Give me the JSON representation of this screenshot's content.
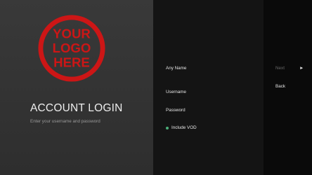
{
  "branding": {
    "logo_lines": [
      "YOUR",
      "LOGO",
      "HERE"
    ],
    "logo_color": "#cc1616"
  },
  "login": {
    "title": "ACCOUNT LOGIN",
    "subtitle": "Enter your username and password"
  },
  "form": {
    "name_label": "Any Name",
    "username_label": "Username",
    "password_label": "Password",
    "vod_label": "Include VOD",
    "vod_checked": true
  },
  "actions": {
    "next_label": "Next",
    "next_icon": "chevron-right-icon",
    "back_label": "Back"
  },
  "colors": {
    "left_panel": "#353535",
    "middle_panel": "#141414",
    "right_panel": "#0a0a0a",
    "vod_indicator": "#4caf7a"
  }
}
